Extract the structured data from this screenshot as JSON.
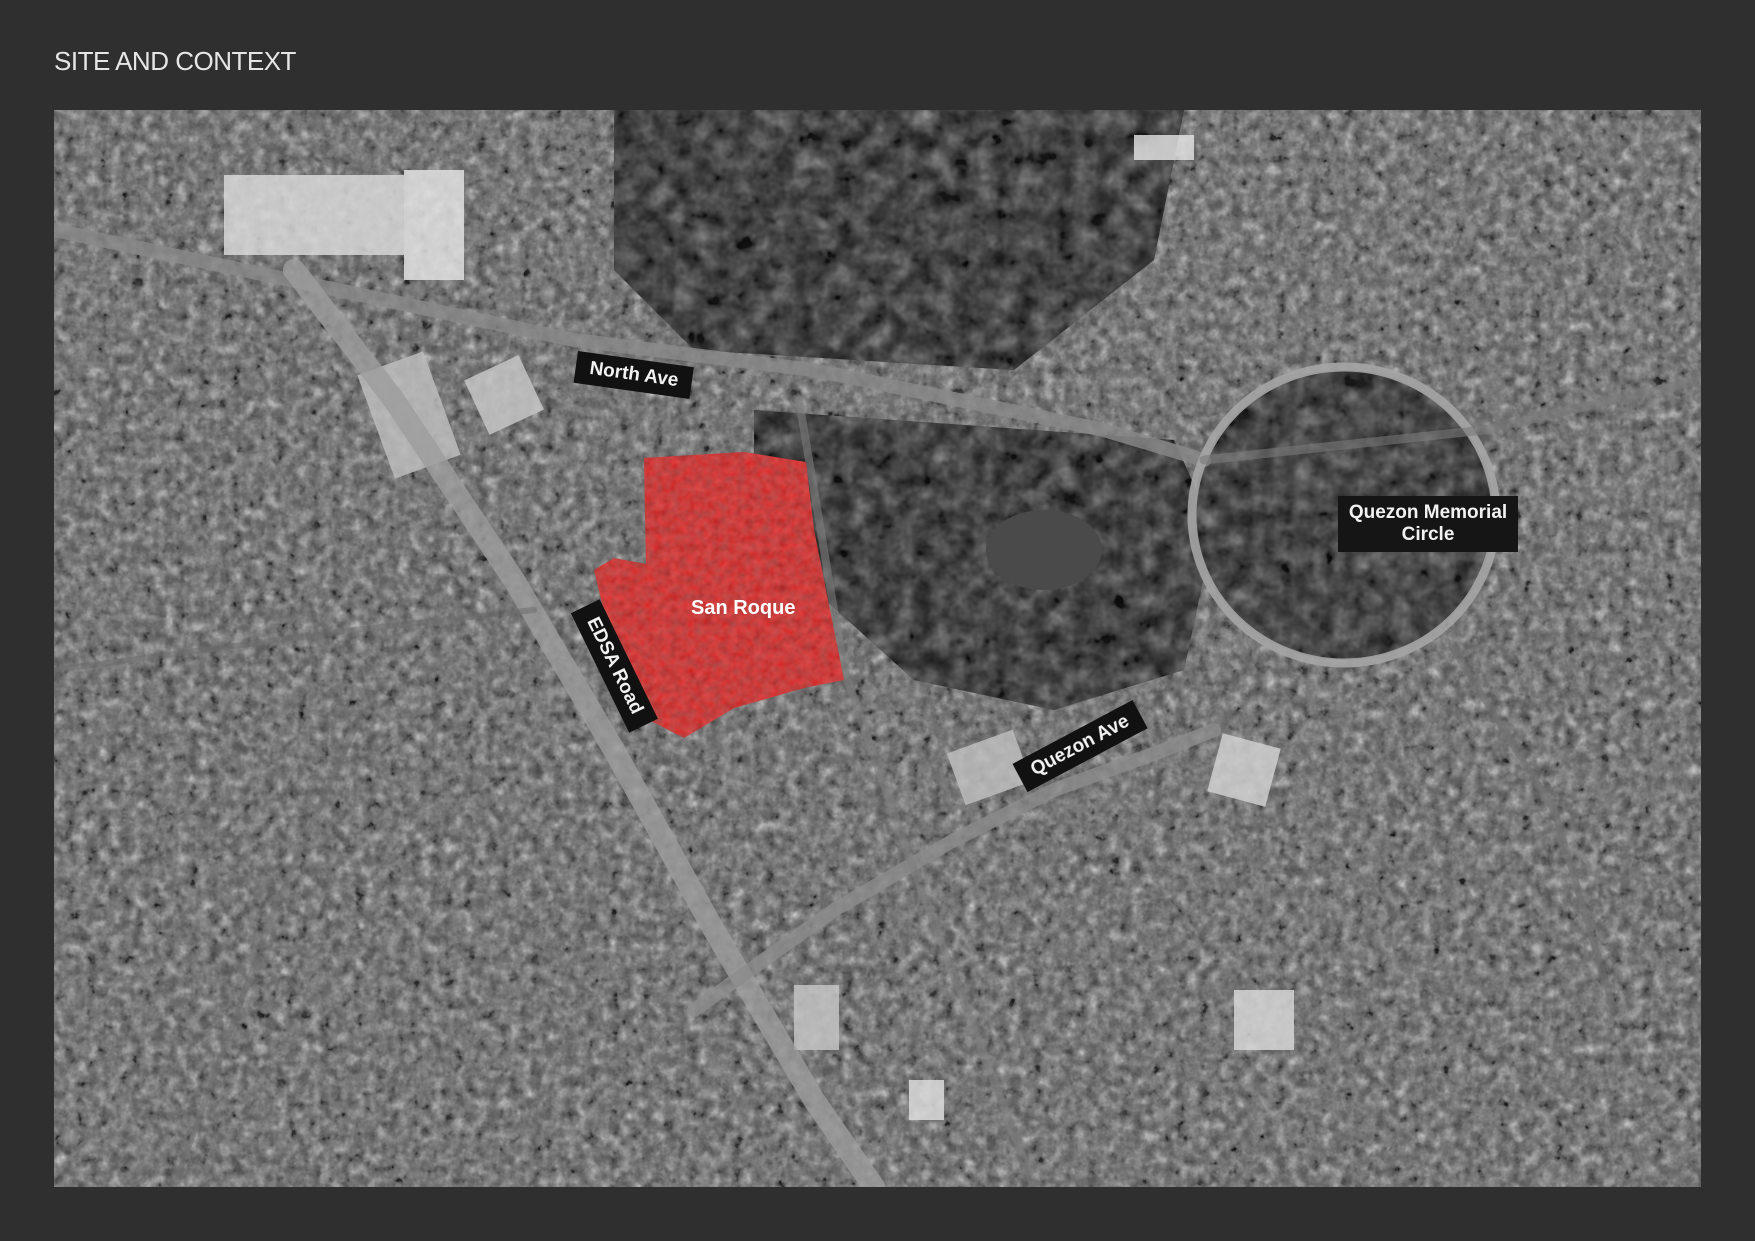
{
  "page": {
    "title": "SITE AND CONTEXT"
  },
  "map": {
    "type": "aerial-satellite-grayscale",
    "highlight_color": "#b3201d",
    "labels": {
      "north_ave": "North Ave",
      "edsa_road": "EDSA Road",
      "quezon_ave": "Quezon Ave",
      "quezon_memorial_circle": "Quezon Memorial Circle",
      "san_roque": "San Roque"
    }
  }
}
